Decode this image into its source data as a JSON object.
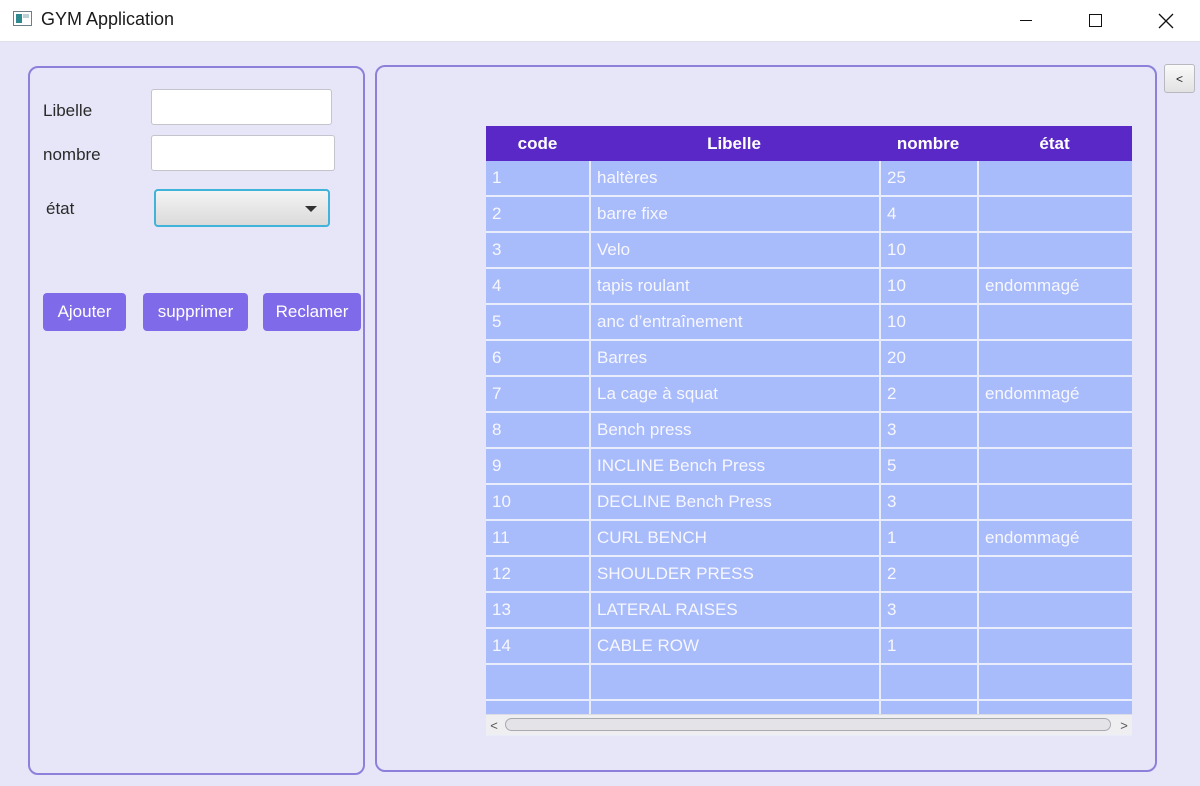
{
  "window": {
    "title": "GYM Application",
    "icon": "app-window-icon",
    "controls": {
      "minimize": "minimize-icon",
      "maximize": "maximize-icon",
      "close": "✕"
    }
  },
  "form": {
    "libelle_label": "Libelle",
    "libelle_value": "",
    "nombre_label": "nombre",
    "nombre_value": "",
    "etat_label": "état",
    "etat_selected": ""
  },
  "buttons": {
    "ajouter": "Ajouter",
    "supprimer": "supprimer",
    "reclamer": "Reclamer"
  },
  "side_button": "<",
  "table": {
    "columns": [
      "code",
      "Libelle",
      "nombre",
      "état"
    ],
    "rows": [
      [
        "1",
        "haltères",
        "25",
        ""
      ],
      [
        "2",
        "barre fixe",
        "4",
        ""
      ],
      [
        "3",
        "Velo",
        "10",
        ""
      ],
      [
        "4",
        "tapis roulant",
        "10",
        "endommagé"
      ],
      [
        "5",
        "anc d’entraînement",
        "10",
        ""
      ],
      [
        "6",
        "Barres",
        "20",
        ""
      ],
      [
        "7",
        "La cage à squat",
        "2",
        "endommagé"
      ],
      [
        "8",
        "Bench press",
        "3",
        ""
      ],
      [
        "9",
        "INCLINE Bench Press",
        "5",
        ""
      ],
      [
        "10",
        "DECLINE Bench Press",
        "3",
        ""
      ],
      [
        "11",
        "CURL BENCH",
        "1",
        "endommagé"
      ],
      [
        "12",
        "SHOULDER PRESS",
        "2",
        ""
      ],
      [
        "13",
        "LATERAL RAISES",
        "3",
        ""
      ],
      [
        "14",
        "CABLE ROW",
        "1",
        ""
      ],
      [
        "",
        "",
        "",
        ""
      ],
      [
        "",
        "",
        "",
        ""
      ]
    ]
  },
  "scrollbar": {
    "left": "<",
    "right": ">"
  },
  "colors": {
    "background": "#e6e6f8",
    "accent": "#7f6aea",
    "table_header": "#5a28c6",
    "table_rows": "#a8bbfa",
    "panel_border": "#8c80da"
  }
}
